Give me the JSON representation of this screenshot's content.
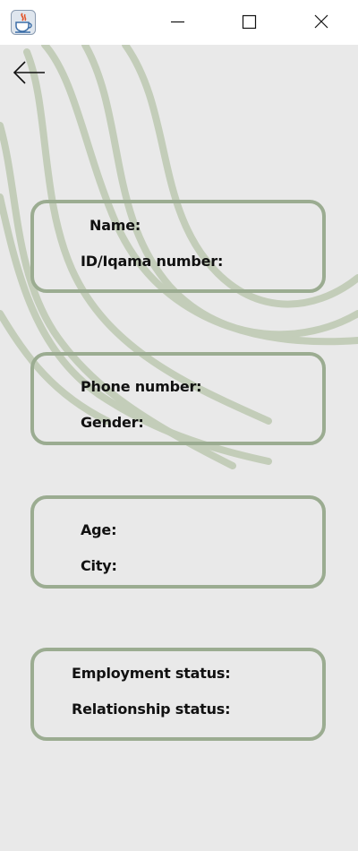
{
  "window": {
    "icons": {
      "app": "java-cup-icon",
      "minimize": "minimize-icon",
      "maximize": "maximize-icon",
      "close": "close-icon"
    }
  },
  "navigation": {
    "back_icon": "arrow-left-icon"
  },
  "colors": {
    "background": "#e9e9e9",
    "card_border": "#9bac91",
    "wave_stroke": "#c3cdb9",
    "titlebar": "#ffffff",
    "text": "#111111"
  },
  "cards": [
    {
      "fields": [
        {
          "label": "Name:"
        },
        {
          "label": "ID/Iqama number:"
        }
      ]
    },
    {
      "fields": [
        {
          "label": "Phone number:"
        },
        {
          "label": "Gender:"
        }
      ]
    },
    {
      "fields": [
        {
          "label": "Age:"
        },
        {
          "label": "City:"
        }
      ]
    },
    {
      "fields": [
        {
          "label": "Employment status:"
        },
        {
          "label": "Relationship status:"
        }
      ]
    }
  ]
}
